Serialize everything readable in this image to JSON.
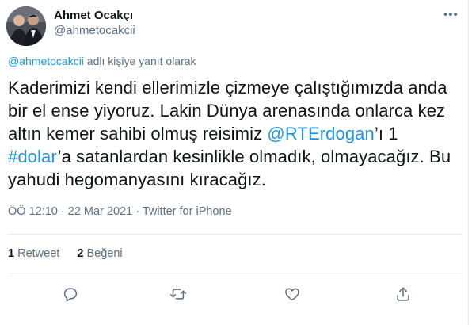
{
  "author": {
    "name": "Ahmet Ocakçı",
    "handle": "@ahmetocakcii"
  },
  "menu_icon": "more-dots-icon",
  "reply": {
    "mention": "@ahmetocakcii",
    "text": " adlı kişiye yanıt olarak"
  },
  "tweet": {
    "t1": "Kaderimizi kendi ellerimizle çizmeye çalıştığımızda anda bir el ense yiyoruz. Lakin Dünya arenasında onlarca kez altın kemer sahibi olmuş reisimiz ",
    "mention": "@RTErdogan",
    "t2": "’ı 1 ",
    "hashtag": "#dolar",
    "t3": "’a satanlardan kesinlikle olmadık, olmayacağız. Bu yahudi hegomanyasını kıracağız."
  },
  "meta": "ÖÖ 12:10 · 22 Mar 2021 · Twitter for iPhone",
  "stats": {
    "retweets_count": "1",
    "retweets_label": "Retweet",
    "likes_count": "2",
    "likes_label": "Beğeni"
  },
  "actions": [
    "reply-icon",
    "retweet-icon",
    "like-icon",
    "share-icon"
  ],
  "colors": {
    "link": "#1b95e0",
    "secondary": "#5b7083",
    "text": "#0f1419",
    "divider": "#e6ecf0"
  }
}
